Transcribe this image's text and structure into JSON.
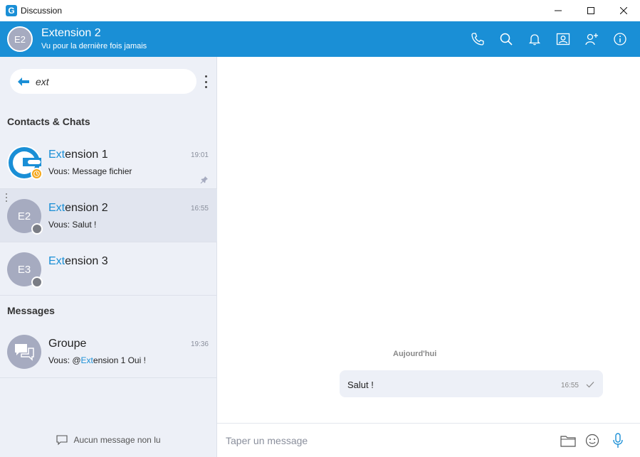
{
  "window": {
    "title": "Discussion",
    "app_icon_letter": "G"
  },
  "header": {
    "avatar_initials": "E2",
    "name": "Extension 2",
    "status": "Vu pour la dernière fois jamais",
    "actions": [
      "phone-icon",
      "search-icon",
      "bell-icon",
      "contact-card-icon",
      "add-user-icon",
      "info-icon"
    ]
  },
  "search": {
    "value": "ext"
  },
  "sections": {
    "contacts": "Contacts & Chats",
    "messages": "Messages"
  },
  "contacts": [
    {
      "name_highlight": "Ext",
      "name_rest": "ension 1",
      "message": "Vous: Message fichier",
      "time": "19:01",
      "status": "away",
      "pinned": true
    },
    {
      "initials": "E2",
      "name_highlight": "Ext",
      "name_rest": "ension 2",
      "message": "Vous: Salut !",
      "time": "16:55",
      "status": "offline",
      "selected": true
    },
    {
      "initials": "E3",
      "name_highlight": "Ext",
      "name_rest": "ension 3",
      "message": "",
      "time": "",
      "status": "offline"
    }
  ],
  "groups": [
    {
      "name": "Groupe",
      "message_prefix": "Vous: @",
      "message_highlight": "Ext",
      "message_rest": "ension 1 Oui !",
      "time": "19:36"
    }
  ],
  "sidebar_footer": {
    "label": "Aucun message non lu"
  },
  "conversation": {
    "date_separator": "Aujourd'hui",
    "messages": [
      {
        "text": "Salut !",
        "time": "16:55",
        "read": true
      }
    ]
  },
  "composer": {
    "placeholder": "Taper un message"
  },
  "colors": {
    "brand": "#1a8fd6",
    "sidebar_bg": "#edf0f7",
    "selected_bg": "#e1e5ef",
    "away": "#f4a81d",
    "offline": "#7a7d85"
  }
}
